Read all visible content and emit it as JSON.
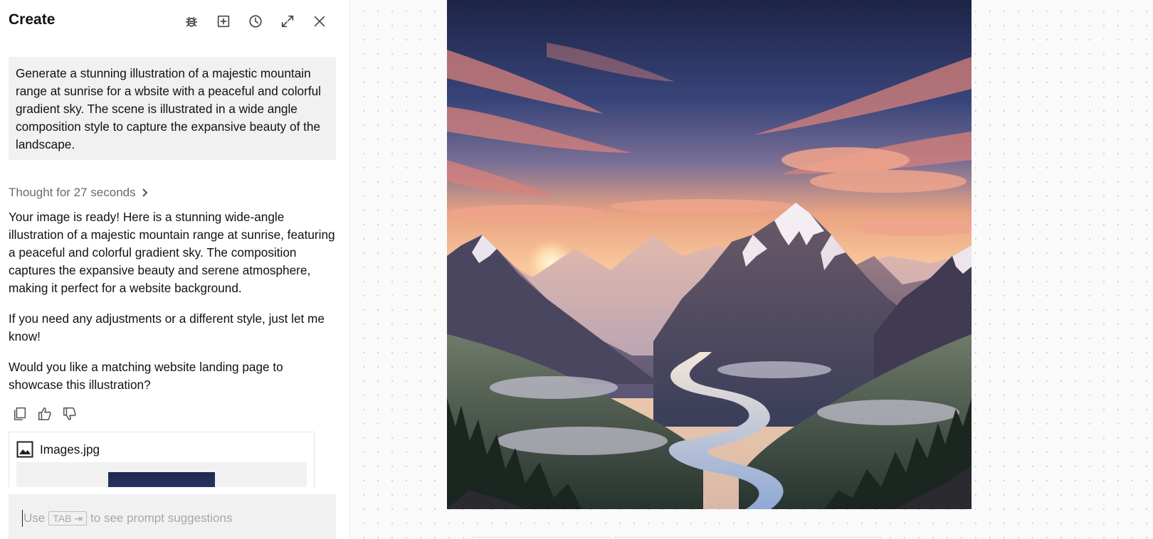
{
  "panel": {
    "title": "Create",
    "header_icons": [
      "bug-icon",
      "add-square-icon",
      "history-clock-icon",
      "expand-icon",
      "close-icon"
    ]
  },
  "prompt": {
    "text": "Generate a stunning illustration of a majestic mountain range at sunrise for a wbsite with a peaceful and colorful gradient sky. The scene is illustrated in a wide angle composition style to capture the expansive beauty of the landscape."
  },
  "thought": {
    "label": "Thought for 27 seconds"
  },
  "response": {
    "paragraph1": "Your image is ready! Here is a stunning wide-angle illustration of a majestic mountain range at sunrise, featuring a peaceful and colorful gradient sky. The composition captures the expansive beauty and serene atmosphere, making it perfect for a website background.",
    "paragraph2": "If you need any adjustments or a different style, just let me know!",
    "paragraph3": "Would you like a matching website landing page to showcase this illustration?"
  },
  "actions": [
    "copy-icon",
    "thumbs-up-icon",
    "thumbs-down-icon"
  ],
  "attachment": {
    "name": "Images.jpg",
    "icon": "image-icon"
  },
  "composer": {
    "placeholder_prefix": "Use",
    "key_hint": "TAB ⇥",
    "placeholder_suffix": "to see prompt suggestions"
  },
  "colors": {
    "panel_bg": "#ffffff",
    "prompt_bg": "#f1f1f1",
    "muted_text": "#6b6b6b",
    "placeholder_text": "#a8a8a8",
    "canvas_bg": "#fafafa",
    "canvas_dot": "#cfcfcf"
  }
}
